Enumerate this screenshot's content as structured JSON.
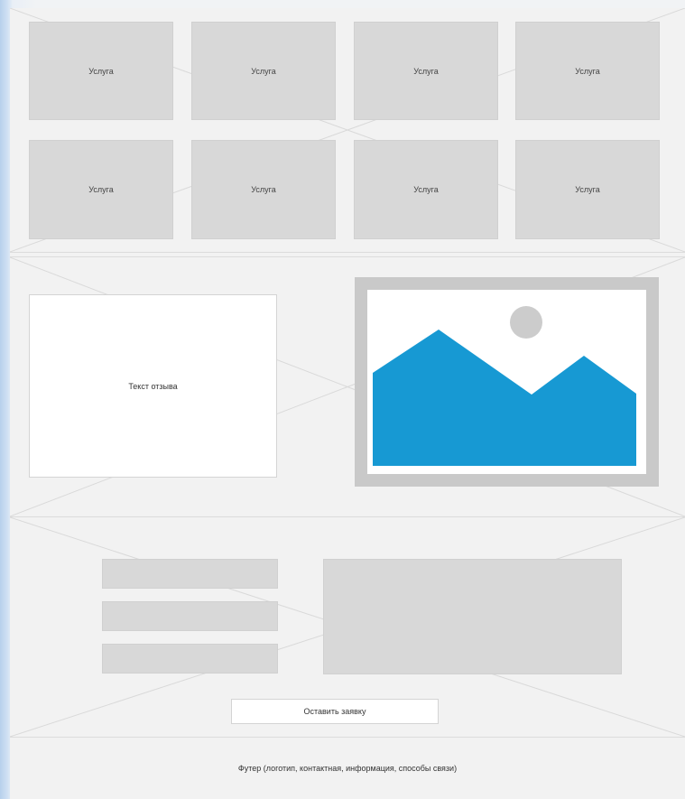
{
  "services": {
    "tiles": [
      "Услуга",
      "Услуга",
      "Услуга",
      "Услуга",
      "Услуга",
      "Услуга",
      "Услуга",
      "Услуга"
    ]
  },
  "review": {
    "text": "Текст отзыва",
    "image": {
      "sky_color": "#ffffff",
      "mountain_color": "#1799d3",
      "sun_color": "#cccccc",
      "frame_color": "#c9c9c9"
    }
  },
  "form": {
    "submit_label": "Оставить заявку"
  },
  "footer": {
    "text": "Футер (логотип, контактная, информация, способы связи)"
  }
}
